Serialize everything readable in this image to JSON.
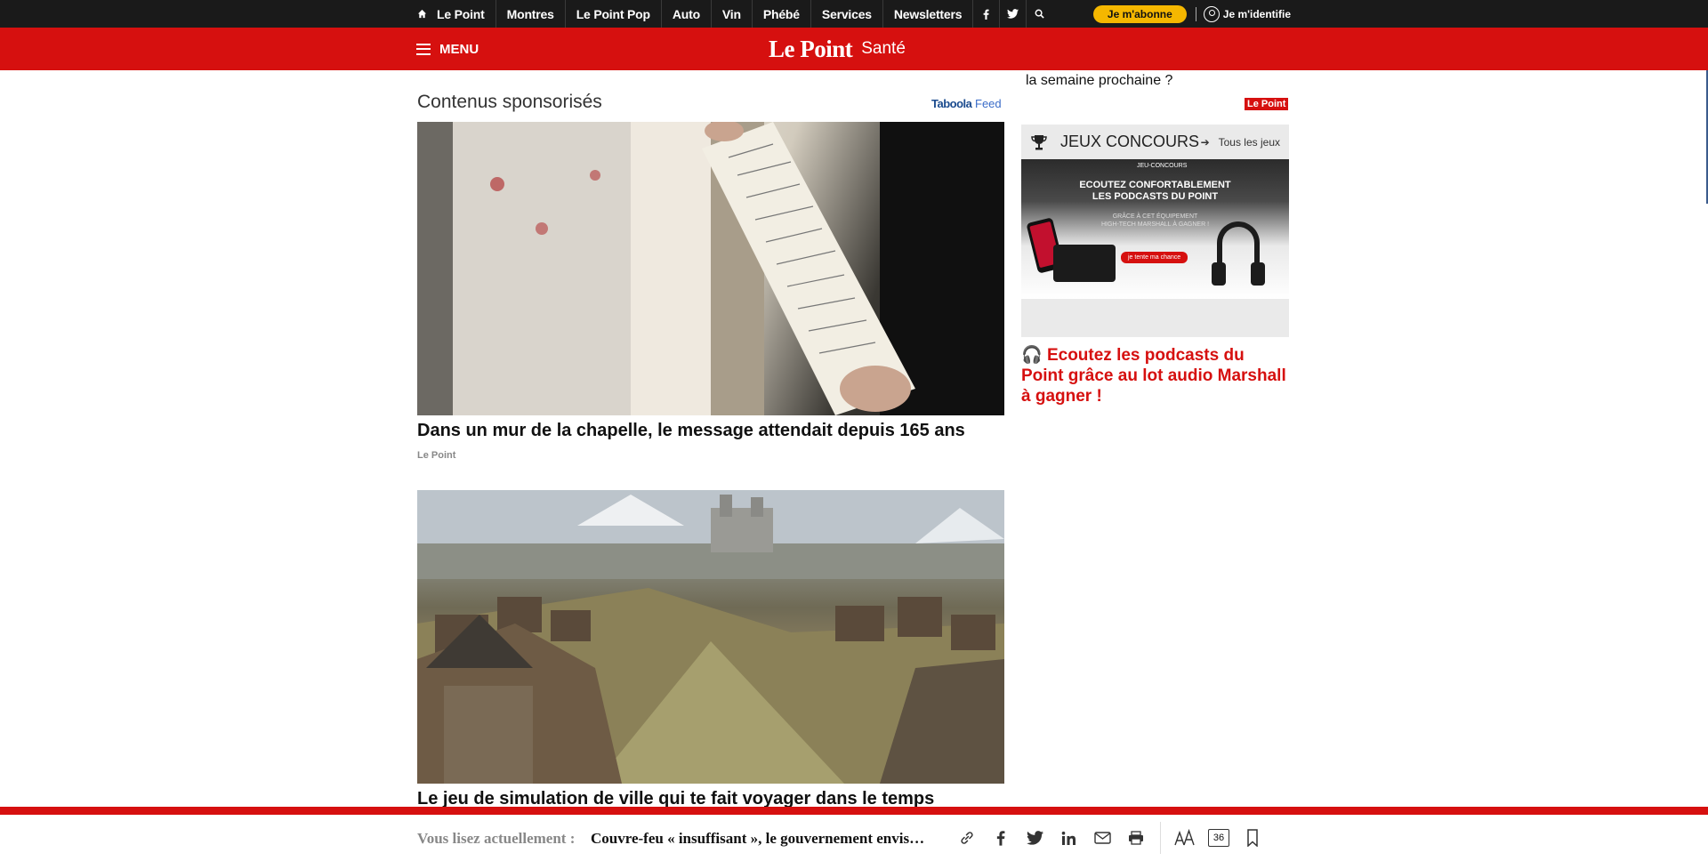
{
  "topbar": {
    "items": [
      "Le Point",
      "Montres",
      "Le Point Pop",
      "Auto",
      "Vin",
      "Phébé",
      "Services",
      "Newsletters"
    ],
    "social_icons": [
      "facebook-icon",
      "twitter-icon",
      "search-icon"
    ],
    "subscribe_label": "Je m'abonne",
    "login_label": "Je m'identifie"
  },
  "header": {
    "menu_label": "MENU",
    "logo_text": "Le Point",
    "section": "Santé"
  },
  "sponsored": {
    "title": "Contenus sponsorisés",
    "provider_brand": "Taboola",
    "provider_suffix": "Feed",
    "items": [
      {
        "title": "Dans un mur de la chapelle, le message attendait depuis 165 ans",
        "source": "Le Point"
      },
      {
        "title": "Le jeu de simulation de ville qui te fait voyager dans le temps",
        "source": ""
      }
    ]
  },
  "sidebar": {
    "teaser_text": "la semaine prochaine ?",
    "badge": "Le Point",
    "contest": {
      "title": "JEUX CONCOURS",
      "all_label": "Tous les jeux",
      "banner_tag": "JEU-CONCOURS",
      "banner_heading_1": "ECOUTEZ CONFORTABLEMENT",
      "banner_heading_2": "LES PODCASTS DU POINT",
      "banner_sub_1": "GRÂCE À CET ÉQUIPEMENT",
      "banner_sub_2": "HIGH-TECH MARSHALL À GAGNER !",
      "banner_cta": "je tente ma chance",
      "promo": "Ecoutez les podcasts du Point grâce au lot audio Marshall à gagner !"
    }
  },
  "readbar": {
    "label": "Vous lisez actuellement :",
    "title": "Couvre-feu « insuffisant », le gouvernement envisage un reconfinement",
    "comment_count": "36",
    "icons": [
      "link-icon",
      "facebook-icon",
      "twitter-icon",
      "linkedin-icon",
      "mail-icon",
      "print-icon",
      "text-size-icon",
      "comments-icon",
      "bookmark-icon"
    ]
  },
  "colors": {
    "brand_red": "#d6100f",
    "subscribe_yellow": "#f5b700",
    "topbar_black": "#1a1a1a"
  }
}
